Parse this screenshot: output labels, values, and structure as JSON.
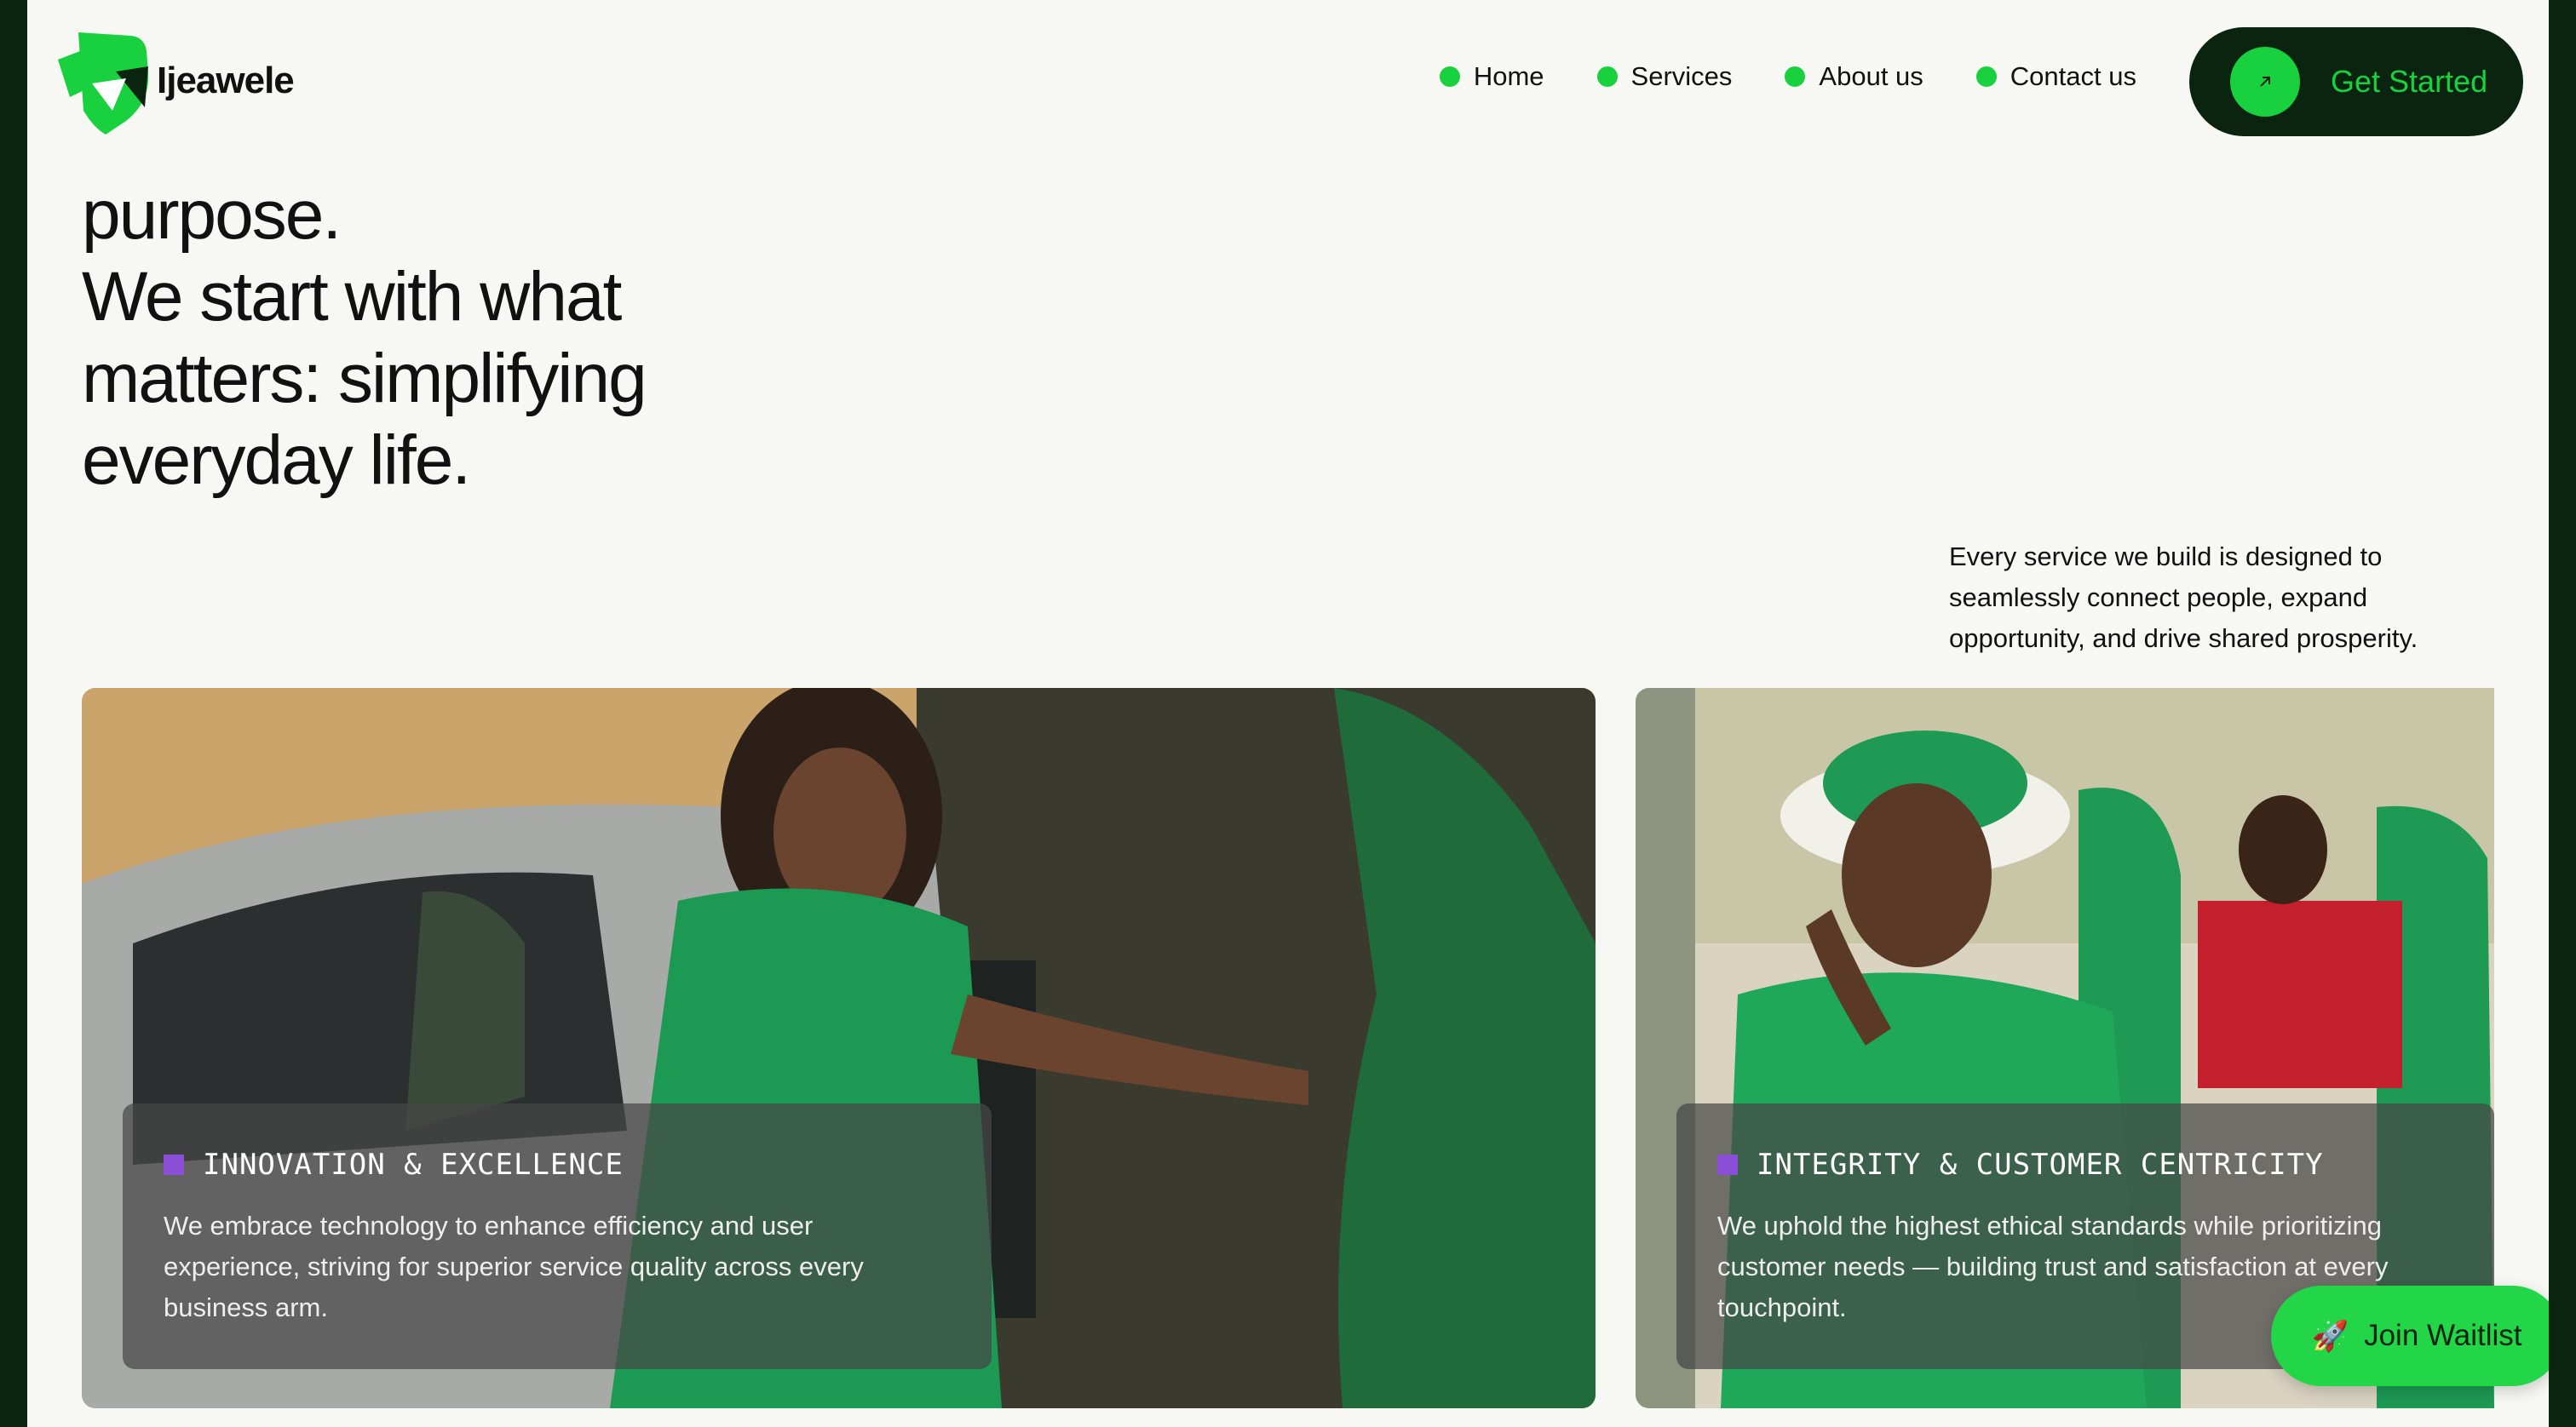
{
  "brand": {
    "name": "Ijeawele"
  },
  "nav": {
    "items": [
      {
        "label": "Home"
      },
      {
        "label": "Services"
      },
      {
        "label": "About us"
      },
      {
        "label": "Contact us"
      }
    ],
    "cta_label": "Get Started",
    "cta_icon": "arrow-up-right-icon"
  },
  "hero": {
    "lines": [
      "purpose.",
      "We start with what",
      "matters: simplifying",
      "everyday life."
    ]
  },
  "intro": "Every service we build is designed to seamlessly connect people, expand opportunity, and drive shared prosperity.",
  "cards": [
    {
      "tag": "INNOVATION & EXCELLENCE",
      "text": "We embrace technology to enhance efficiency and user experience, striving for superior service quality across every business arm."
    },
    {
      "tag": "INTEGRITY & CUSTOMER CENTRICITY",
      "text": "We uphold the highest ethical standards while prioritizing customer needs — building trust and satisfaction at every touchpoint."
    }
  ],
  "waitlist": {
    "icon": "rocket-icon",
    "label": "Join Waitlist"
  },
  "colors": {
    "accent": "#19d13f",
    "dark": "#0b2410",
    "tag": "#8a4fd6",
    "background": "#f7f7f3"
  }
}
